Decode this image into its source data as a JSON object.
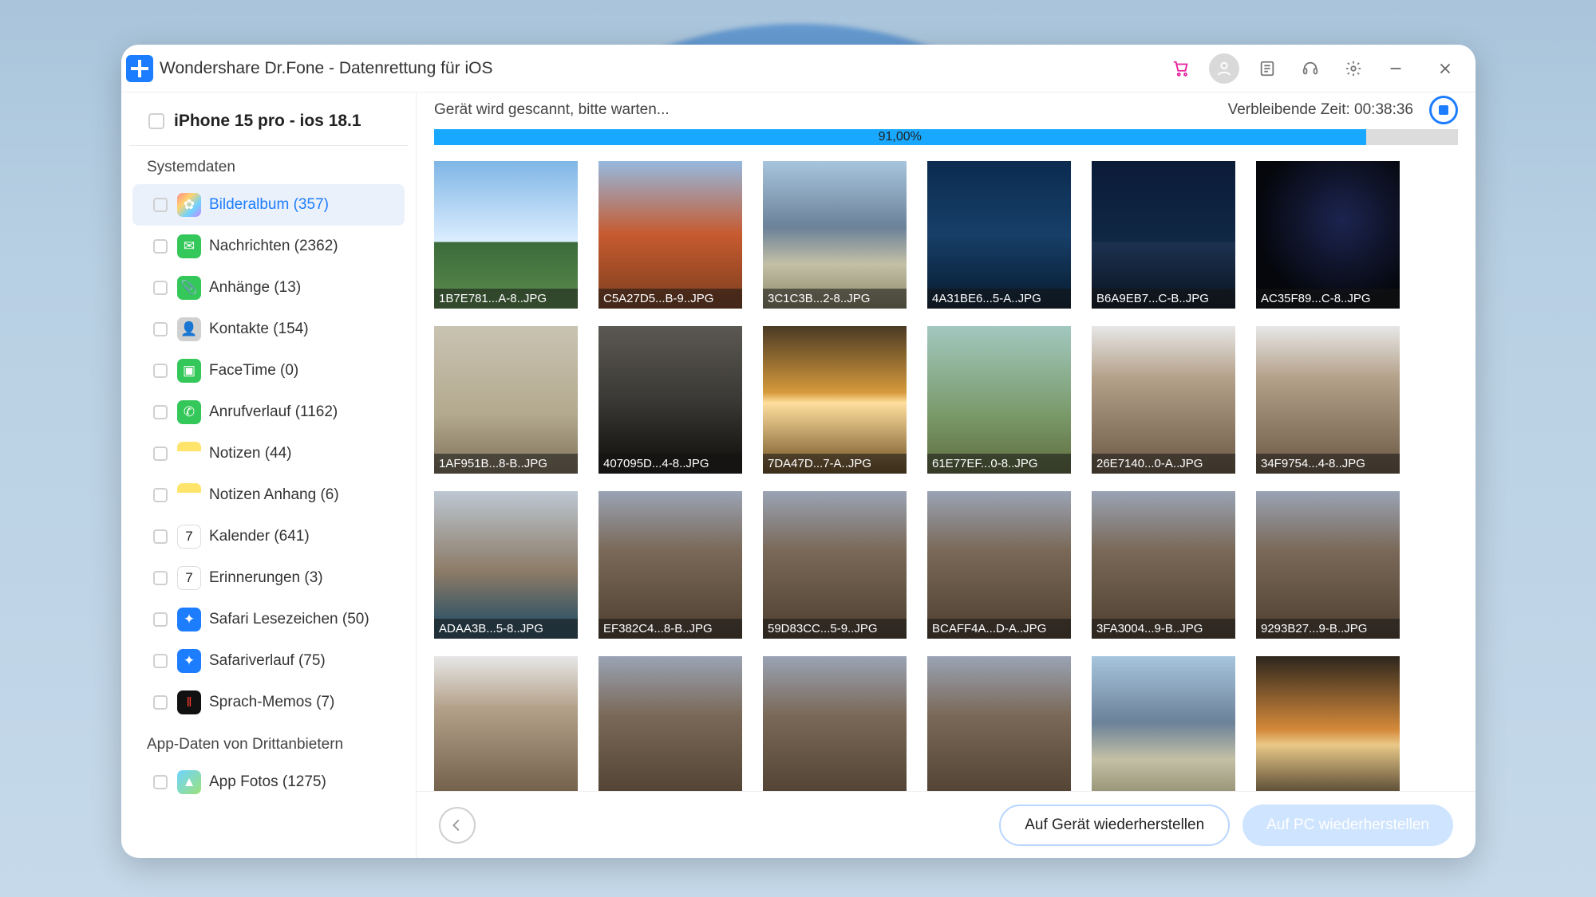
{
  "app": {
    "title": "Wondershare Dr.Fone - Datenrettung für iOS"
  },
  "device": {
    "label": "iPhone 15 pro - ios 18.1"
  },
  "sidebar": {
    "group1_label": "Systemdaten",
    "group2_label": "App-Daten von Drittanbietern",
    "items": [
      {
        "label": "Bilderalbum (357)",
        "icon_bg": "linear-gradient(135deg,#ff8a8a,#ffd36e,#6ed3ff,#c48aff)",
        "glyph": "✿",
        "selected": true
      },
      {
        "label": "Nachrichten (2362)",
        "icon_bg": "#34c759",
        "glyph": "✉"
      },
      {
        "label": "Anhänge (13)",
        "icon_bg": "#34c759",
        "glyph": "📎"
      },
      {
        "label": "Kontakte (154)",
        "icon_bg": "#d0d0d0",
        "glyph": "👤"
      },
      {
        "label": "FaceTime (0)",
        "icon_bg": "#34c759",
        "glyph": "▣"
      },
      {
        "label": "Anrufverlauf (1162)",
        "icon_bg": "#34c759",
        "glyph": "✆"
      },
      {
        "label": "Notizen (44)",
        "icon_bg": "linear-gradient(#ffe46b 0 40%,#fff 40%)",
        "glyph": ""
      },
      {
        "label": "Notizen Anhang (6)",
        "icon_bg": "linear-gradient(#ffe46b 0 40%,#fff 40%)",
        "glyph": ""
      },
      {
        "label": "Kalender (641)",
        "icon_bg": "#fff",
        "glyph": "7",
        "glyph_color": "#222",
        "border": "1px solid #ddd"
      },
      {
        "label": "Erinnerungen (3)",
        "icon_bg": "#fff",
        "glyph": "7",
        "glyph_color": "#222",
        "border": "1px solid #ddd"
      },
      {
        "label": "Safari Lesezeichen (50)",
        "icon_bg": "#1d7dff",
        "glyph": "✦"
      },
      {
        "label": "Safariverlauf (75)",
        "icon_bg": "#1d7dff",
        "glyph": "✦"
      },
      {
        "label": "Sprach-Memos (7)",
        "icon_bg": "#111",
        "glyph": "‖",
        "glyph_color": "#ff3b30"
      }
    ],
    "items2": [
      {
        "label": "App Fotos (1275)",
        "icon_bg": "linear-gradient(135deg,#6ed3ff,#9be27a)",
        "glyph": "▲"
      }
    ]
  },
  "scan": {
    "status": "Gerät wird gescannt, bitte warten...",
    "time_label": "Verbleibende Zeit: 00:38:36",
    "percent_label": "91,00%",
    "percent": 91
  },
  "thumbs": [
    {
      "fn": "1B7E781...A-8..JPG",
      "cls": "sky",
      "selected": true
    },
    {
      "fn": "C5A27D5...B-9..JPG",
      "cls": "brick"
    },
    {
      "fn": "3C1C3B...2-8..JPG",
      "cls": "peak"
    },
    {
      "fn": "4A31BE6...5-A..JPG",
      "cls": "seadusk"
    },
    {
      "fn": "B6A9EB7...C-B..JPG",
      "cls": "citynite"
    },
    {
      "fn": "AC35F89...C-8..JPG",
      "cls": "dark"
    },
    {
      "fn": "1AF951B...8-B..JPG",
      "cls": "mist"
    },
    {
      "fn": "407095D...4-8..JPG",
      "cls": "dusk"
    },
    {
      "fn": "7DA47D...7-A..JPG",
      "cls": "sunset"
    },
    {
      "fn": "61E77EF...0-8..JPG",
      "cls": "greencl"
    },
    {
      "fn": "26E7140...0-A..JPG",
      "cls": "cliff"
    },
    {
      "fn": "34F9754...4-8..JPG",
      "cls": "cliff"
    },
    {
      "fn": "ADAA3B...5-8..JPG",
      "cls": "rocksea"
    },
    {
      "fn": "EF382C4...8-B..JPG",
      "cls": "rock"
    },
    {
      "fn": "59D83CC...5-9..JPG",
      "cls": "rock"
    },
    {
      "fn": "BCAFF4A...D-A..JPG",
      "cls": "rock"
    },
    {
      "fn": "3FA3004...9-B..JPG",
      "cls": "rock"
    },
    {
      "fn": "9293B27...9-B..JPG",
      "cls": "rock"
    },
    {
      "fn": "",
      "cls": "cliff"
    },
    {
      "fn": "",
      "cls": "rock"
    },
    {
      "fn": "",
      "cls": "rock"
    },
    {
      "fn": "",
      "cls": "rock"
    },
    {
      "fn": "",
      "cls": "peak"
    },
    {
      "fn": "",
      "cls": "sunset2"
    }
  ],
  "footer": {
    "btn_device": "Auf Gerät wiederherstellen",
    "btn_pc": "Auf PC wiederherstellen"
  }
}
